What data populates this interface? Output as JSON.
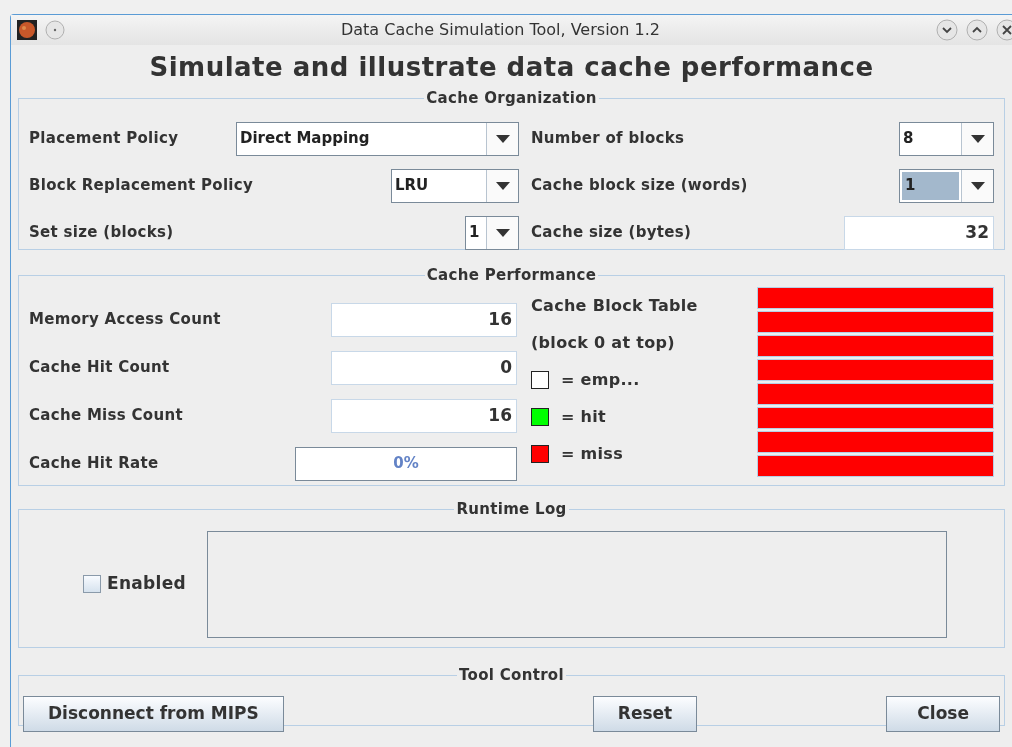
{
  "window": {
    "title": "Data Cache Simulation Tool, Version 1.2"
  },
  "heading": "Simulate and illustrate data cache performance",
  "organization": {
    "title": "Cache Organization",
    "left": [
      {
        "label": "Placement Policy",
        "kind": "combo",
        "value": "Direct Mapping",
        "highlighted": false
      },
      {
        "label": "Block Replacement Policy",
        "kind": "combo",
        "value": "LRU",
        "highlighted": false
      },
      {
        "label": "Set size (blocks)",
        "kind": "combo",
        "value": "1",
        "highlighted": false
      }
    ],
    "right": [
      {
        "label": "Number of blocks",
        "kind": "combo",
        "value": "8",
        "highlighted": false
      },
      {
        "label": "Cache block size (words)",
        "kind": "combo",
        "value": "1",
        "highlighted": true
      },
      {
        "label": "Cache size (bytes)",
        "kind": "text",
        "value": "32"
      }
    ]
  },
  "performance": {
    "title": "Cache Performance",
    "counters": [
      {
        "label": "Memory Access Count",
        "kind": "text",
        "value": "16"
      },
      {
        "label": "Cache Hit Count",
        "kind": "text",
        "value": "0"
      },
      {
        "label": "Cache Miss Count",
        "kind": "text",
        "value": "16"
      },
      {
        "label": "Cache Hit Rate",
        "kind": "progress",
        "value": "0%",
        "level": 0
      }
    ],
    "table_title": "Cache Block Table",
    "table_note": "(block 0 at top)",
    "legend": [
      {
        "label": "= emp...",
        "color": "#ffffff"
      },
      {
        "label": "= hit",
        "color": "#00ff00"
      },
      {
        "label": "= miss",
        "color": "#ff0000"
      }
    ],
    "blocks": [
      {
        "color": "#ff0000"
      },
      {
        "color": "#ff0000"
      },
      {
        "color": "#ff0000"
      },
      {
        "color": "#ff0000"
      },
      {
        "color": "#ff0000"
      },
      {
        "color": "#ff0000"
      },
      {
        "color": "#ff0000"
      },
      {
        "color": "#ff0000"
      }
    ]
  },
  "runtime_log": {
    "title": "Runtime Log",
    "checkbox": {
      "label": "Enabled",
      "checked": false
    }
  },
  "tool_control": {
    "title": "Tool Control",
    "buttons": [
      "Disconnect from MIPS",
      "Reset",
      "Close"
    ]
  }
}
